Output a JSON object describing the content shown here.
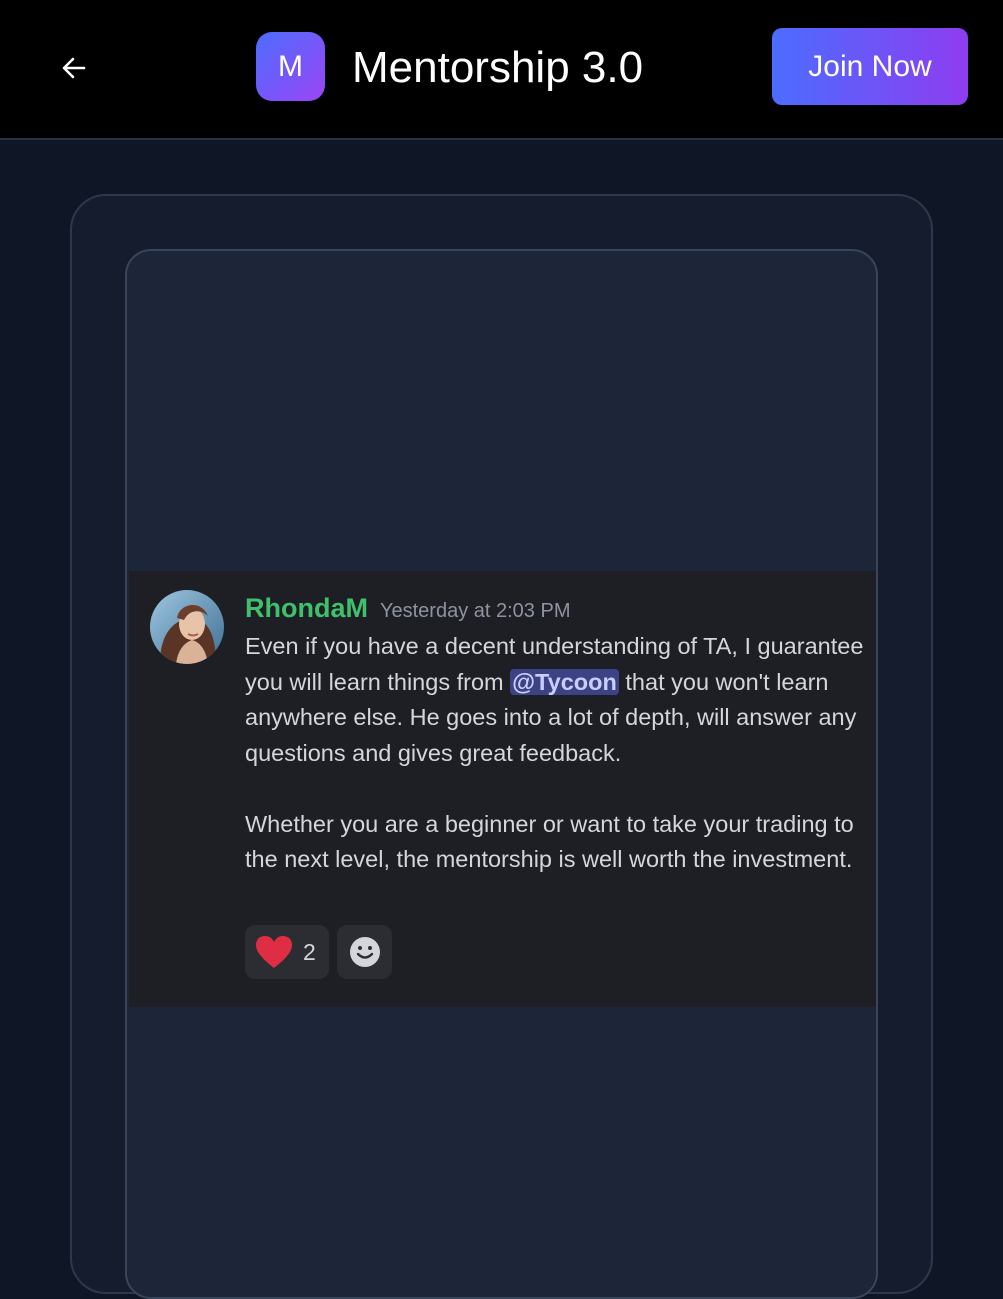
{
  "header": {
    "back_icon": "arrow-left-icon",
    "logo_letter": "M",
    "title": "Mentorship 3.0",
    "join_label": "Join Now"
  },
  "message": {
    "username": "RhondaM",
    "timestamp": "Yesterday at 2:03 PM",
    "line1_before": "Even if you have a decent understanding of TA, I guarantee you will learn things from ",
    "mention": "@Tycoon",
    "line1_after": " that you won't learn anywhere else. He goes into a lot of depth, will answer any questions and gives great feedback.",
    "paragraph2": "Whether you are a beginner or want to take your trading to the next level, the mentorship is well worth the investment."
  },
  "reactions": {
    "heart_icon": "heart-icon",
    "heart_count": "2",
    "add_icon": "add-reaction-icon"
  },
  "colors": {
    "username": "#3fc16b",
    "mention_bg": "#3c4384",
    "accent_start": "#4b6dff",
    "accent_end": "#8e3df0"
  }
}
